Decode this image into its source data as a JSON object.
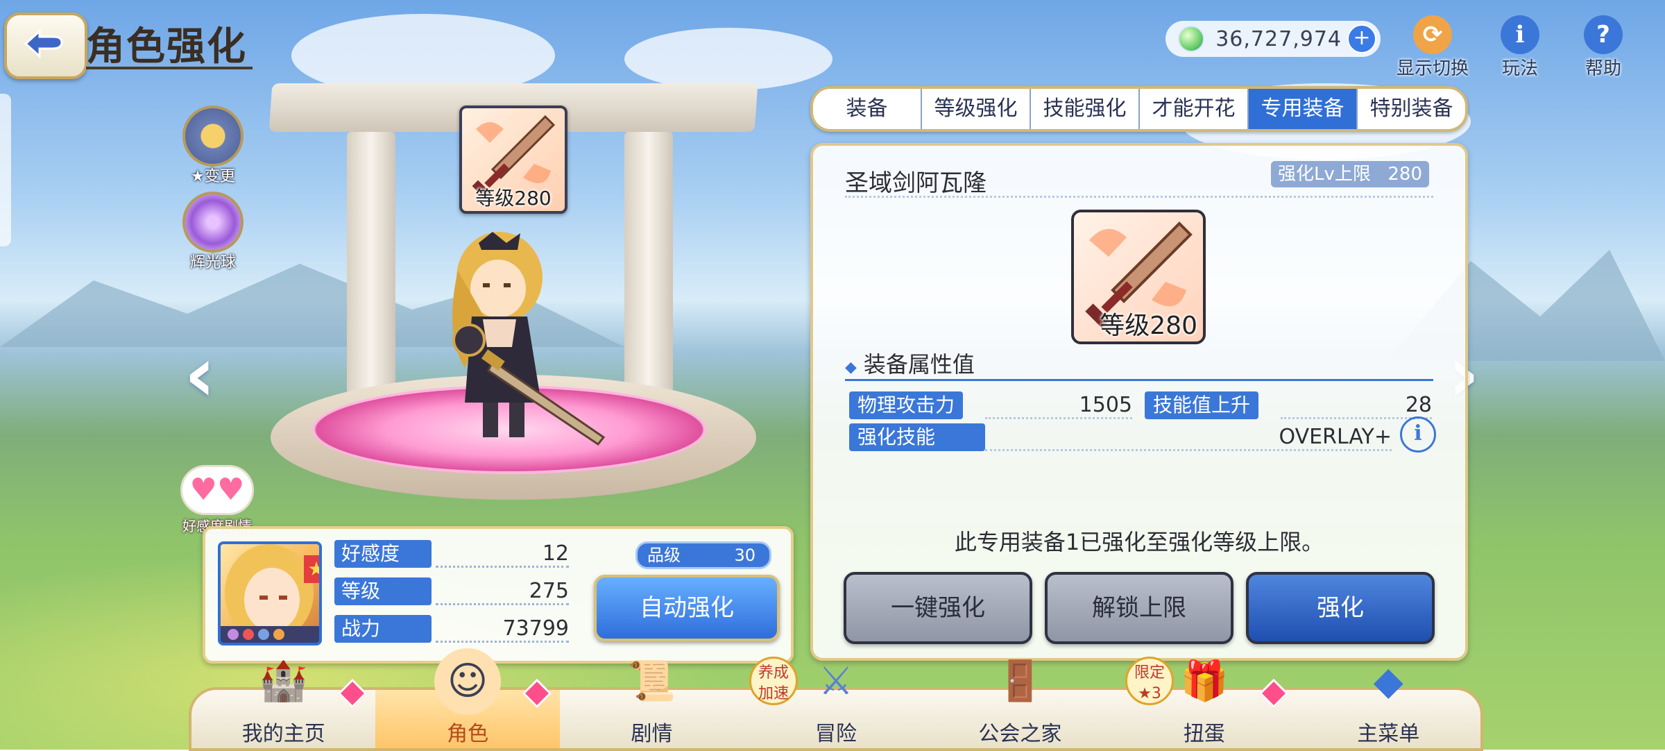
{
  "header": {
    "title": "角色强化",
    "currency_amount": "36,727,974",
    "icons": [
      {
        "label": "显示切换",
        "icon": "display-switch-icon"
      },
      {
        "label": "玩法",
        "icon": "info-icon"
      },
      {
        "label": "帮助",
        "icon": "help-icon"
      }
    ]
  },
  "side": {
    "change_label": "★变更",
    "orb_label": "辉光球",
    "affinity_label": "好感度剧情"
  },
  "stage": {
    "equip_level": "等级280"
  },
  "character": {
    "stats": [
      {
        "label": "好感度",
        "value": "12"
      },
      {
        "label": "等级",
        "value": "275"
      },
      {
        "label": "战力",
        "value": "73799"
      }
    ],
    "rank_label": "品级",
    "rank_value": "30",
    "auto_button": "自动强化"
  },
  "tabs": [
    "装备",
    "等级强化",
    "技能强化",
    "才能开花",
    "专用装备",
    "特别装备"
  ],
  "active_tab": 4,
  "equipment": {
    "name": "圣域剑阿瓦隆",
    "lv_cap_label": "强化Lv上限",
    "lv_cap_value": "280",
    "level_text": "等级280",
    "section_title": "装备属性值",
    "props": {
      "atk_label": "物理攻击力",
      "atk_value": "1505",
      "tp_label": "技能值上升",
      "tp_value": "28",
      "skill_label": "强化技能",
      "skill_value": "OVERLAY+"
    },
    "notice": "此专用装备1已强化至强化等级上限。",
    "buttons": {
      "one_click": "一键强化",
      "unlock": "解锁上限",
      "enhance": "强化"
    }
  },
  "nav": {
    "items": [
      "我的主页",
      "角色",
      "剧情",
      "冒险",
      "公会之家",
      "扭蛋",
      "主菜单"
    ],
    "active": 1,
    "tag_boost": "养成\n加速",
    "tag_limited": "限定\n★3"
  },
  "colors": {
    "accent_blue": "#2f6fd6",
    "gold_border": "#d2b56c",
    "badge_pink": "#ff4f8b"
  }
}
